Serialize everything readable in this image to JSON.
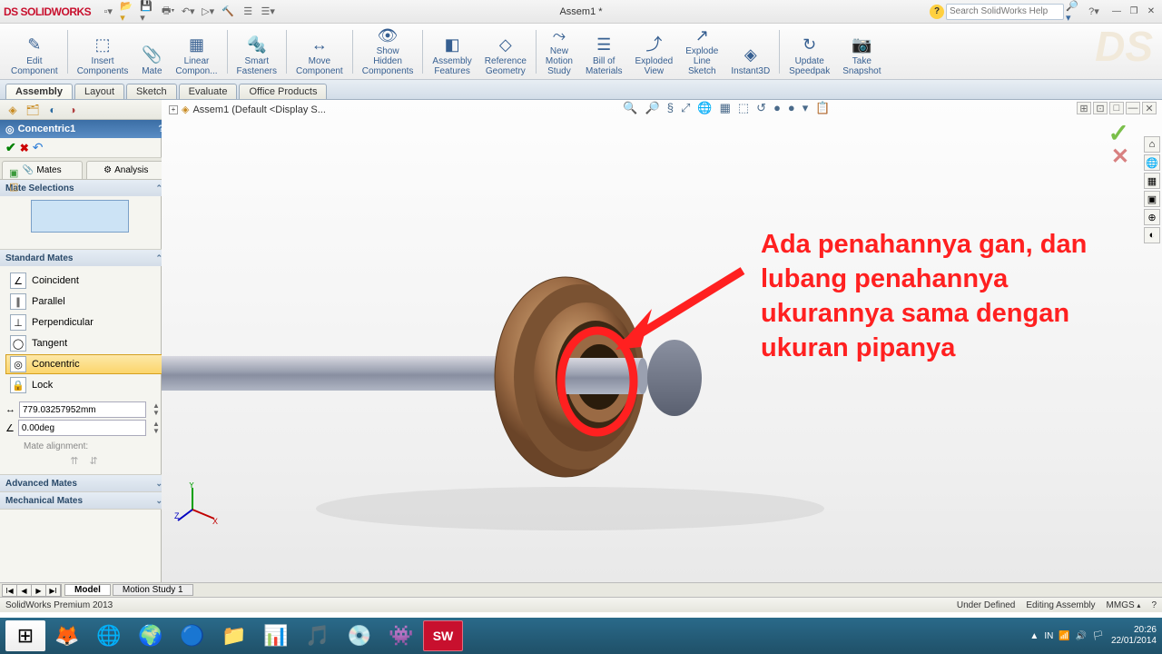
{
  "titlebar": {
    "logo_prefix": "DS",
    "logo": "SOLIDWORKS",
    "title": "Assem1 *",
    "search_placeholder": "Search SolidWorks Help",
    "help_glyph": "?",
    "min": "—",
    "restore": "❐",
    "close": "✕"
  },
  "ribbon": {
    "buttons": [
      {
        "label": "Edit\nComponent",
        "icon": "✎"
      },
      {
        "label": "Insert\nComponents",
        "icon": "⬚"
      },
      {
        "label": "Mate",
        "icon": "📎"
      },
      {
        "label": "Linear\nCompon...",
        "icon": "▦"
      },
      {
        "label": "Smart\nFasteners",
        "icon": "🔩"
      },
      {
        "label": "Move\nComponent",
        "icon": "↔"
      },
      {
        "label": "Show\nHidden\nComponents",
        "icon": "👁"
      },
      {
        "label": "Assembly\nFeatures",
        "icon": "◧"
      },
      {
        "label": "Reference\nGeometry",
        "icon": "◇"
      },
      {
        "label": "New\nMotion\nStudy",
        "icon": "⤳"
      },
      {
        "label": "Bill of\nMaterials",
        "icon": "☰"
      },
      {
        "label": "Exploded\nView",
        "icon": "⤴"
      },
      {
        "label": "Explode\nLine\nSketch",
        "icon": "↗"
      },
      {
        "label": "Instant3D",
        "icon": "◈"
      },
      {
        "label": "Update\nSpeedpak",
        "icon": "↻"
      },
      {
        "label": "Take\nSnapshot",
        "icon": "📷"
      }
    ],
    "ds_logo": "DS"
  },
  "tabs": [
    "Assembly",
    "Layout",
    "Sketch",
    "Evaluate",
    "Office Products"
  ],
  "active_tab": 0,
  "crumb": "Assem1  (Default <Display S...",
  "propmgr": {
    "title": "Concentric1",
    "ok": "✔",
    "cancel": "✖",
    "undo": "↶",
    "subtabs": [
      "Mates",
      "Analysis"
    ],
    "sections": {
      "mate_selections": "Mate Selections",
      "standard": "Standard Mates",
      "advanced": "Advanced Mates",
      "mechanical": "Mechanical Mates"
    },
    "std_mates": [
      {
        "label": "Coincident",
        "icon": "∠"
      },
      {
        "label": "Parallel",
        "icon": "∥"
      },
      {
        "label": "Perpendicular",
        "icon": "⊥"
      },
      {
        "label": "Tangent",
        "icon": "◯"
      },
      {
        "label": "Concentric",
        "icon": "◎",
        "sel": true
      },
      {
        "label": "Lock",
        "icon": "🔒"
      }
    ],
    "distance": "779.03257952mm",
    "angle": "0.00deg",
    "alignment": "Mate alignment:"
  },
  "viewport_btns": [
    "🔍",
    "🔎",
    "§",
    "⤢",
    "🌐",
    "▦",
    "⬚",
    "↺",
    "●",
    "●",
    "▾",
    "📋"
  ],
  "corner": [
    "⊞",
    "⊡",
    "□",
    "—",
    "✕"
  ],
  "right_tools": [
    "⌂",
    "🌐",
    "▦",
    "▣",
    "⊕",
    "◐"
  ],
  "accept": "✓",
  "reject": "✕",
  "annotation": "Ada penahannya gan, dan lubang penahannya ukurannya sama dengan ukuran pipanya",
  "sheets": {
    "nav": [
      "I◀",
      "◀",
      "▶",
      "▶I"
    ],
    "tabs": [
      "Model",
      "Motion Study 1"
    ]
  },
  "status": {
    "left": "SolidWorks Premium 2013",
    "under": "Under Defined",
    "mode": "Editing Assembly",
    "units": "MMGS",
    "qm": "?"
  },
  "taskbar": {
    "apps": [
      "⊞",
      "🦊",
      "🌐",
      "🌍",
      "🔵",
      "📁",
      "📊",
      "🎵",
      "💿",
      "👾",
      "SW"
    ],
    "active": 10,
    "tray": [
      "▲",
      "IN",
      "📶",
      "🔊",
      "🏳"
    ],
    "time": "20:26",
    "date": "22/01/2014"
  }
}
